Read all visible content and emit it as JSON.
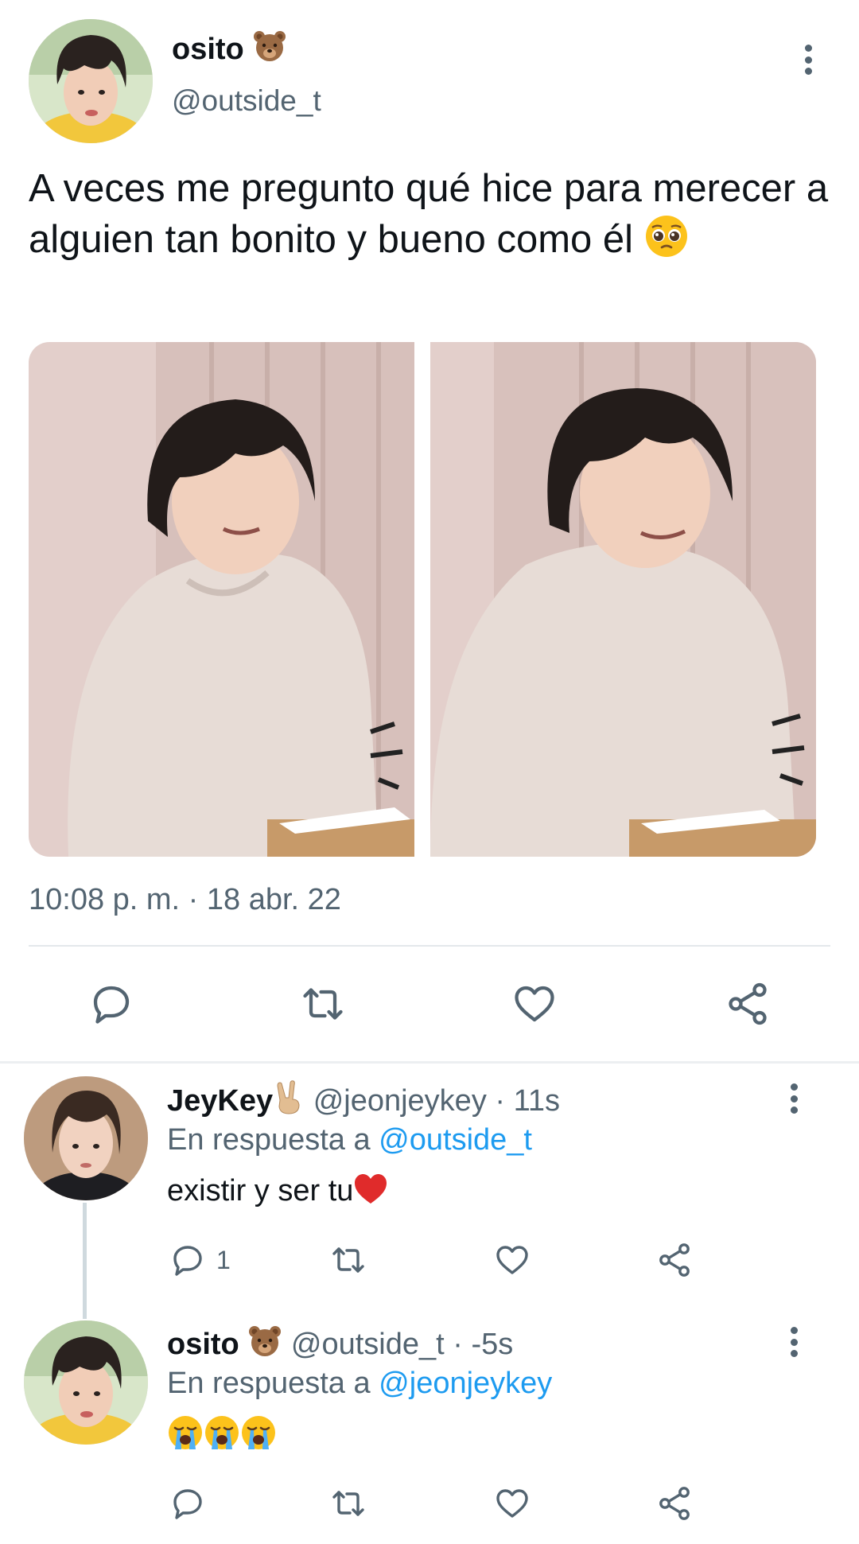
{
  "main_tweet": {
    "display_name": "osito",
    "name_emoji": "bear-face-emoji",
    "handle": "@outside_t",
    "text": "A veces me pregunto qué hice para merecer a alguien tan bonito y bueno como él",
    "text_emoji": "pleading-face-emoji",
    "media_count": 2,
    "timestamp": "10:08 p. m. · 18 abr. 22",
    "actions": [
      "reply-icon",
      "retweet-icon",
      "like-icon",
      "share-icon"
    ]
  },
  "replies": [
    {
      "display_name": "JeyKey",
      "name_emoji": "victory-hand-emoji",
      "handle": "@jeonjeykey",
      "time": "· 11s",
      "reply_prefix": "En respuesta a",
      "reply_mention": "@outside_t",
      "text": "existir y ser tu",
      "text_emoji": "red-heart-emoji",
      "reply_count": "1"
    },
    {
      "display_name": "osito",
      "name_emoji": "bear-face-emoji",
      "handle": "@outside_t",
      "time": "· -5s",
      "reply_prefix": "En respuesta a",
      "reply_mention": "@jeonjeykey",
      "text": "",
      "text_emoji": "loudly-crying-face-emoji x3"
    }
  ],
  "colors": {
    "primary_text": "#0f1419",
    "secondary_text": "#536471",
    "link": "#1d9bf0",
    "divider": "#e4e8eb",
    "thread_line": "#cfd9de"
  }
}
